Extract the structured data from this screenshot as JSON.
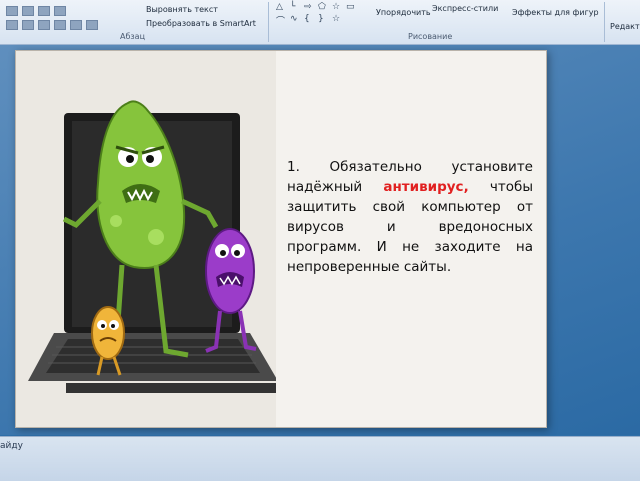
{
  "ribbon": {
    "align_text": "Выровнять текст",
    "smartart": "Преобразовать в SmartArt",
    "paragraph_group": "Абзац",
    "arrange": "Упорядочить",
    "quick_styles": "Экспресс-стили",
    "shape_effects": "Эффекты для фигур",
    "drawing_group": "Рисование",
    "edit_cut": "Редакти"
  },
  "slide": {
    "text_before": "1. Обязательно установите надёжный ",
    "text_red": "антивирус,",
    "text_after": " чтобы защитить свой компьютер от вирусов и вредоносных программ. И не заходите на непроверенные сайты."
  },
  "status": {
    "partial_text": "айду"
  },
  "colors": {
    "highlight": "#e12020",
    "workspace": "#3d77ae"
  }
}
